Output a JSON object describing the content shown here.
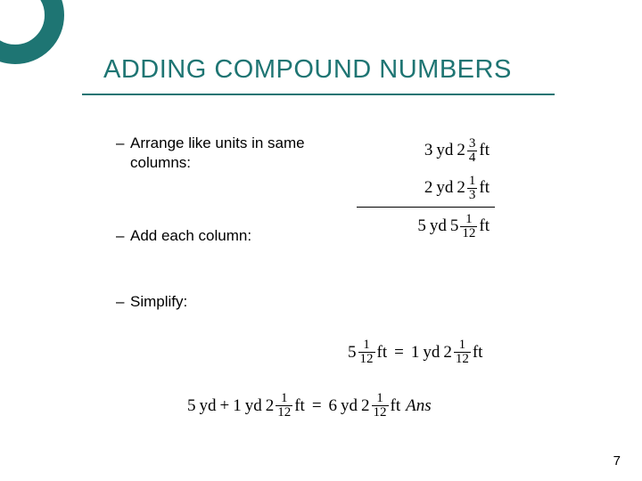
{
  "title": "ADDING COMPOUND NUMBERS",
  "bullets": {
    "dash": "–",
    "item1": "Arrange like units in same columns:",
    "item2": "Add each column:",
    "item3": "Simplify:"
  },
  "units": {
    "yd": "yd",
    "ft": "ft"
  },
  "rows": {
    "r1": {
      "whole_yd": "3",
      "whole_ft": "2",
      "num": "3",
      "den": "4"
    },
    "r2": {
      "whole_yd": "2",
      "whole_ft": "2",
      "num": "1",
      "den": "3"
    },
    "sum": {
      "whole_yd": "5",
      "whole_ft": "5",
      "num": "1",
      "den": "12"
    }
  },
  "conversion": {
    "lhs_whole": "5",
    "lhs_num": "1",
    "lhs_den": "12",
    "lhs_unit": "ft",
    "eq": "=",
    "rhs_yd": "1",
    "rhs_ft_whole": "2",
    "rhs_num": "1",
    "rhs_den": "12"
  },
  "final": {
    "a_yd": "5",
    "plus": "+",
    "b_yd": "1",
    "b_ft_whole": "2",
    "b_num": "1",
    "b_den": "12",
    "eq": "=",
    "c_yd": "6",
    "c_ft_whole": "2",
    "c_num": "1",
    "c_den": "12",
    "ans": "Ans"
  },
  "page": "7"
}
